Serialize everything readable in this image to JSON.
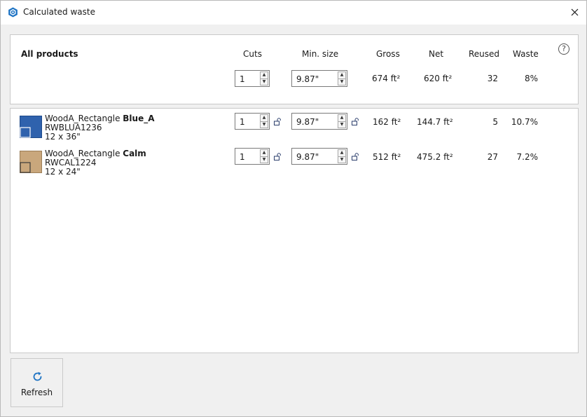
{
  "window": {
    "title": "Calculated waste",
    "accent_color": "#1f74c4"
  },
  "header": {
    "all_products_label": "All products",
    "columns": {
      "cuts": "Cuts",
      "min_size": "Min. size",
      "gross": "Gross",
      "net": "Net",
      "reused": "Reused",
      "waste": "Waste"
    },
    "totals": {
      "cuts": "1",
      "min_size": "9.87\"",
      "gross": "674 ft²",
      "net": "620 ft²",
      "reused": "32",
      "waste": "8%"
    },
    "help_label": "?"
  },
  "products": [
    {
      "name_prefix": "WoodA_Rectangle",
      "name_bold": "Blue_A",
      "code": "RWBLUA1236",
      "size": "12 x 36\"",
      "swatch_color": "#2f62ad",
      "cuts": "1",
      "min_size": "9.87\"",
      "gross": "162 ft²",
      "net": "144.7 ft²",
      "reused": "5",
      "waste": "10.7%"
    },
    {
      "name_prefix": "WoodA_Rectangle",
      "name_bold": "Calm",
      "code": "RWCAL1224",
      "size": "12 x 24\"",
      "swatch_color": "#c9a77c",
      "cuts": "1",
      "min_size": "9.87\"",
      "gross": "512 ft²",
      "net": "475.2 ft²",
      "reused": "27",
      "waste": "7.2%"
    }
  ],
  "footer": {
    "refresh_label": "Refresh"
  }
}
